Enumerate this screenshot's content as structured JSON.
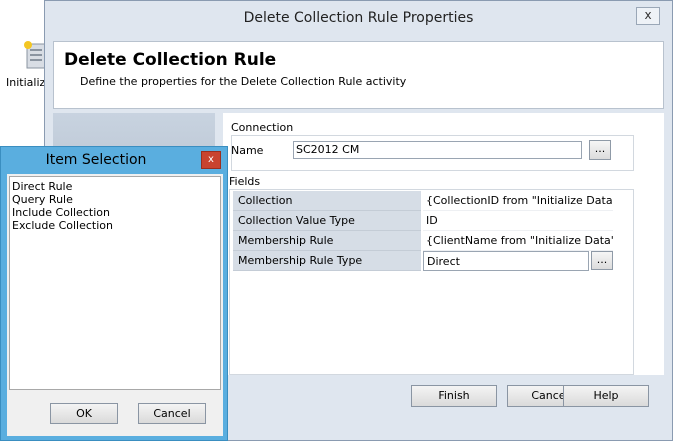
{
  "background": {
    "canvas_item_label": "Initializ",
    "canvas_item_icon": "activity-icon"
  },
  "main_dialog": {
    "title": "Delete Collection Rule Properties",
    "close_glyph": "x",
    "header": {
      "title": "Delete Collection Rule",
      "subtitle": "Define the properties for the Delete Collection Rule activity"
    },
    "connection": {
      "group_label": "Connection",
      "name_label": "Name",
      "name_value": "SC2012 CM",
      "browse_label": "..."
    },
    "fields": {
      "group_label": "Fields",
      "rows": [
        {
          "name": "Collection",
          "value": "{CollectionID from \"Initialize Data\"}"
        },
        {
          "name": "Collection Value Type",
          "value": "ID"
        },
        {
          "name": "Membership Rule",
          "value": "{ClientName from \"Initialize Data\"}"
        },
        {
          "name": "Membership Rule Type",
          "value": "Direct"
        }
      ],
      "browse_label": "..."
    },
    "footer": {
      "finish": "Finish",
      "cancel": "Cancel",
      "help": "Help"
    }
  },
  "item_selection": {
    "title": "Item Selection",
    "close_glyph": "x",
    "items": [
      "Direct Rule",
      "Query Rule",
      "Include Collection",
      "Exclude Collection"
    ],
    "ok": "OK",
    "cancel": "Cancel"
  },
  "colors": {
    "dialog_bg": "#dfe6ef",
    "selection_frame": "#5aaedf",
    "close_red": "#c9432f",
    "grid_label_bg": "#d6dde6"
  }
}
